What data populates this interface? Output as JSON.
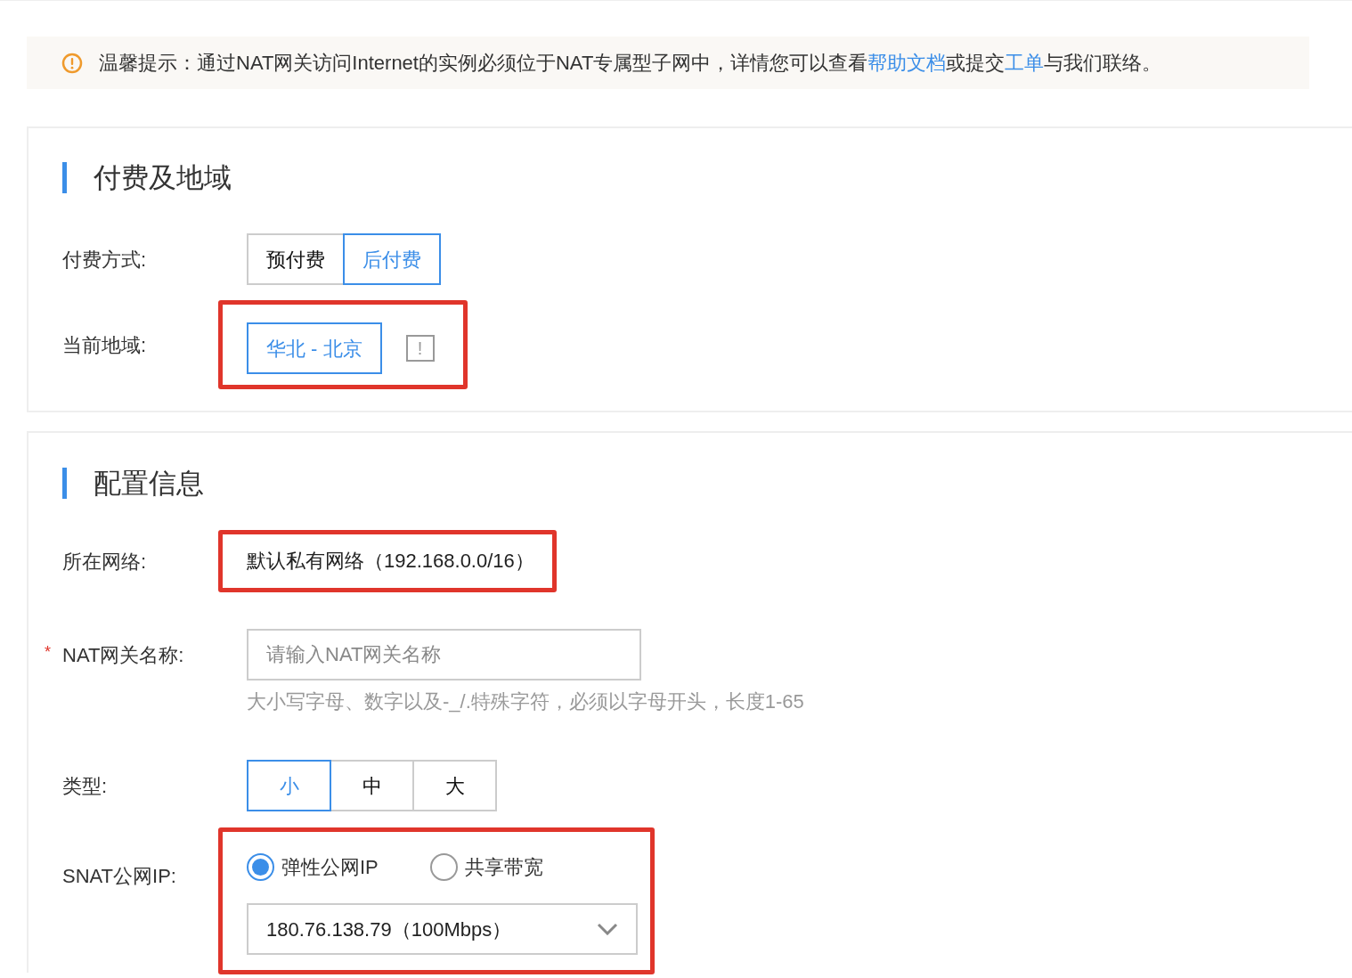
{
  "notice": {
    "segments": [
      {
        "kind": "text",
        "text": "温馨提示：通过NAT网关访问Internet的实例必须位于NAT专属型子网中，详情您可以查看"
      },
      {
        "kind": "link",
        "text": "帮助文档"
      },
      {
        "kind": "text",
        "text": "或提交"
      },
      {
        "kind": "link",
        "text": "工单"
      },
      {
        "kind": "text",
        "text": "与我们联络。"
      }
    ]
  },
  "billing_section": {
    "title": "付费及地域",
    "billing": {
      "label": "付费方式:",
      "options": [
        {
          "label": "预付费",
          "selected": false
        },
        {
          "label": "后付费",
          "selected": true
        }
      ]
    },
    "region": {
      "label": "当前地域:",
      "highlighted": true,
      "options": [
        {
          "label": "华北 - 北京",
          "selected": true
        }
      ],
      "info_glyph": "!"
    }
  },
  "config_section": {
    "title": "配置信息",
    "network": {
      "label": "所在网络:",
      "highlighted": true,
      "value": "默认私有网络（192.168.0.0/16）"
    },
    "gateway_name": {
      "required_mark": "*",
      "label": "NAT网关名称:",
      "placeholder": "请输入NAT网关名称",
      "hint": "大小写字母、数字以及-_/.特殊字符，必须以字母开头，长度1-65"
    },
    "type": {
      "label": "类型:",
      "options": [
        {
          "label": "小",
          "selected": true
        },
        {
          "label": "中",
          "selected": false
        },
        {
          "label": "大",
          "selected": false
        }
      ]
    },
    "snat": {
      "label": "SNAT公网IP:",
      "highlighted": true,
      "radios": [
        {
          "label": "弹性公网IP",
          "selected": true
        },
        {
          "label": "共享带宽",
          "selected": false
        }
      ],
      "select_value": "180.76.138.79（100Mbps）"
    }
  }
}
